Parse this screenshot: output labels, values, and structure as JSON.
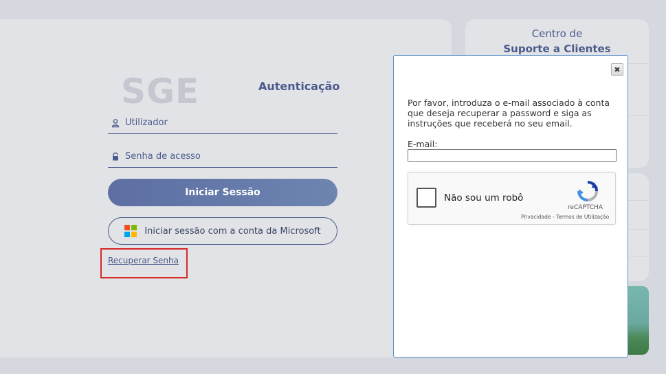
{
  "support": {
    "title_line1": "Centro de",
    "title_line2": "Suporte a Clientes"
  },
  "login": {
    "logo_text": "SGE",
    "auth_title": "Autenticação",
    "username_label": "Utilizador",
    "password_label": "Senha de acesso",
    "login_button": "Iniciar Sessão",
    "microsoft_button": "Iniciar sessão com a conta da Microsoft",
    "recover_link": "Recuperar Senha"
  },
  "modal": {
    "close_label": "✖",
    "instructions": "Por favor, introduza o e-mail associado à conta que deseja recuperar a password e siga as instruções que receberá no seu email.",
    "email_label": "E-mail:",
    "email_value": "",
    "captcha": {
      "label": "Não sou um robô",
      "brand": "reCAPTCHA",
      "links": "Privacidade - Termos de Utilização",
      "checked": false
    }
  },
  "colors": {
    "accent": "#4a5a8c",
    "highlight": "#d72828",
    "modal_border": "#5a8fc8"
  },
  "icons": [
    "user-icon",
    "lock-icon",
    "microsoft-logo-icon",
    "close-icon",
    "recaptcha-icon"
  ]
}
